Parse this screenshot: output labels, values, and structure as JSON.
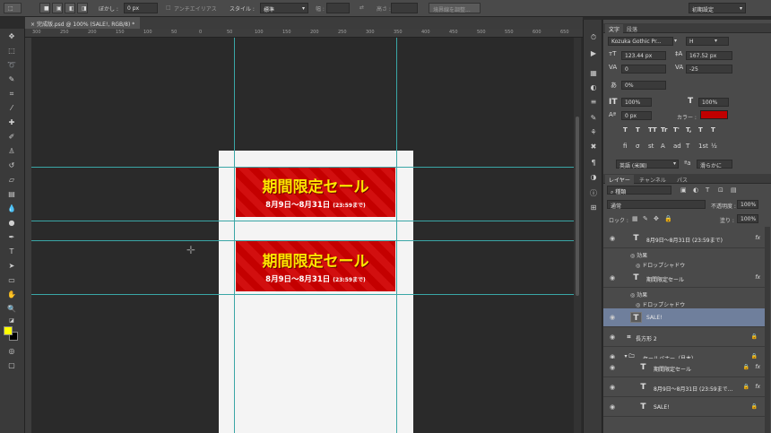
{
  "options_bar": {
    "feather_label": "ぼかし :",
    "feather_value": "0 px",
    "antialias_label": "アンチエイリアス",
    "style_label": "スタイル :",
    "style_value": "標準",
    "width_label": "幅 :",
    "height_label": "高さ :",
    "refine_edge": "境界線を調整...",
    "workspace": "初期設定"
  },
  "document_tab": {
    "title": "完成版.psd @ 100% (SALE!, RGB/8) *",
    "close": "×"
  },
  "ruler": {
    "ticks": [
      "300",
      "250",
      "200",
      "150",
      "100",
      "50",
      "0",
      "50",
      "100",
      "150",
      "200",
      "250",
      "300",
      "350",
      "400",
      "450",
      "500",
      "550",
      "600",
      "650"
    ]
  },
  "banners": [
    {
      "heading": "期間限定セール",
      "dates": "8月9日〜8月31日",
      "time": "(23:59まで)"
    },
    {
      "heading": "期間限定セール",
      "dates": "8月9日〜8月31日",
      "time": "(23:59まで)"
    }
  ],
  "character_panel": {
    "tabs": [
      "文字",
      "段落"
    ],
    "font_family": "Kozuka Gothic Pr...",
    "font_style": "H",
    "font_size": "123.44 px",
    "leading": "167.52 px",
    "kerning": "0",
    "tracking": "-25",
    "scale_label": "0%",
    "vertical_scale": "100%",
    "horizontal_scale": "100%",
    "baseline_shift": "0 px",
    "color_label": "カラー :",
    "color": "#c00000",
    "style_buttons": [
      "T",
      "T",
      "TT",
      "Tr",
      "T'",
      "T,",
      "T",
      "T"
    ],
    "opentype_buttons": [
      "fi",
      "σ",
      "st",
      "A",
      "ad",
      "T",
      "1st",
      "½"
    ],
    "language": "英語 (米国)",
    "antialias": "滑らかに"
  },
  "layers_panel": {
    "tabs": [
      "レイヤー",
      "チャンネル",
      "パス"
    ],
    "filter_kind": "種類",
    "blend_mode": "通常",
    "opacity_label": "不透明度 :",
    "opacity": "100%",
    "lock_label": "ロック :",
    "fill_label": "塗り :",
    "fill": "100%",
    "layers": [
      {
        "name": "8月9日〜8月31日 (23:59まで)",
        "type": "T",
        "fx": "fx"
      },
      {
        "name": "効果",
        "type": "effects"
      },
      {
        "name": "ドロップシャドウ",
        "type": "effect"
      },
      {
        "name": "期間限定セール",
        "type": "T",
        "fx": "fx"
      },
      {
        "name": "効果",
        "type": "effects"
      },
      {
        "name": "ドロップシャドウ",
        "type": "effect"
      },
      {
        "name": "SALE!",
        "type": "T",
        "selected": true
      },
      {
        "name": "長方形 2",
        "type": "shape"
      },
      {
        "name": "セールバナー（見本）",
        "type": "group"
      },
      {
        "name": "期間限定セール",
        "type": "T",
        "fx": "fx"
      },
      {
        "name": "8月9日〜8月31日 (23:59まで...",
        "type": "T",
        "fx": "fx"
      },
      {
        "name": "SALE!",
        "type": "T"
      }
    ]
  },
  "colors": {
    "foreground": "#ffff00",
    "background": "#000000",
    "guide": "#3aa6a6",
    "banner_red": "#c40000"
  }
}
